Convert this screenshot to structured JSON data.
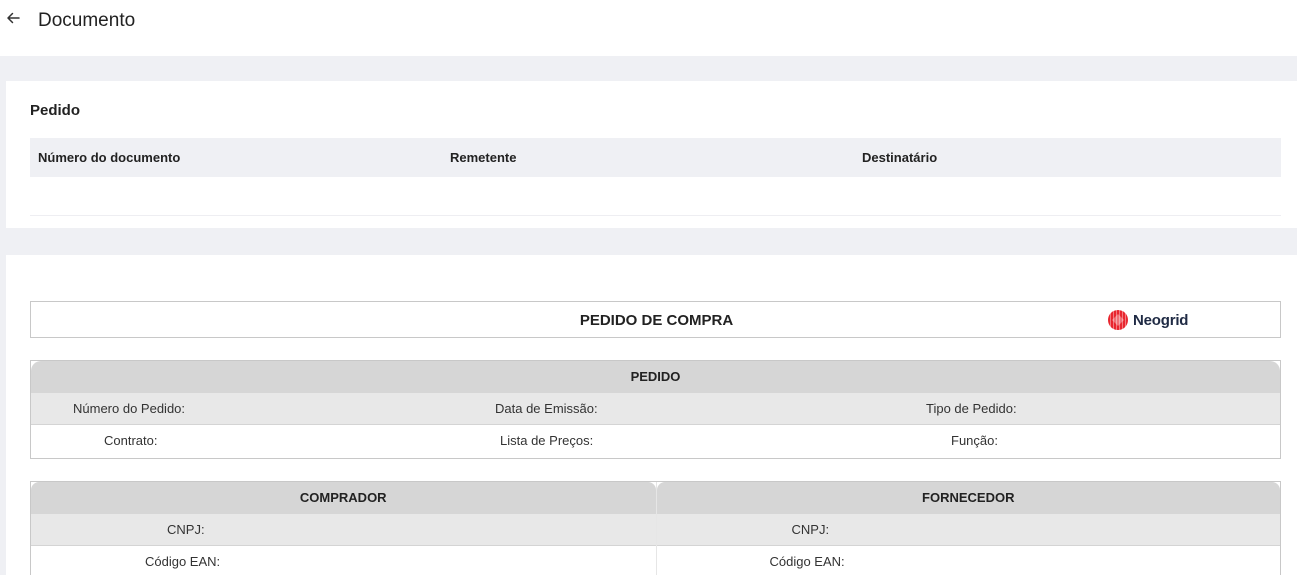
{
  "header": {
    "title": "Documento"
  },
  "pedido_card": {
    "title": "Pedido",
    "columns": [
      "Número do documento",
      "Remetente",
      "Destinatário"
    ]
  },
  "purchase_order": {
    "title": "PEDIDO DE COMPRA",
    "logo_text": "Neogrid",
    "pedido_section": {
      "title": "PEDIDO",
      "numero_do_pedido": "Número do Pedido:",
      "data_de_emissao": "Data de Emissão:",
      "tipo_de_pedido": "Tipo de Pedido:",
      "contrato": "Contrato:",
      "lista_de_precos": "Lista de Preços:",
      "funcao": "Função:"
    },
    "comprador": {
      "title": "COMPRADOR",
      "cnpj": "CNPJ:",
      "codigo_ean": "Código EAN:"
    },
    "fornecedor": {
      "title": "FORNECEDOR",
      "cnpj": "CNPJ:",
      "codigo_ean": "Código EAN:"
    }
  },
  "colors": {
    "page_bg": "#eff0f4",
    "table_header": "#d6d6d6",
    "row_gray": "#e8e8e8",
    "logo_red": "#e8262f",
    "logo_text": "#1f2a44"
  }
}
